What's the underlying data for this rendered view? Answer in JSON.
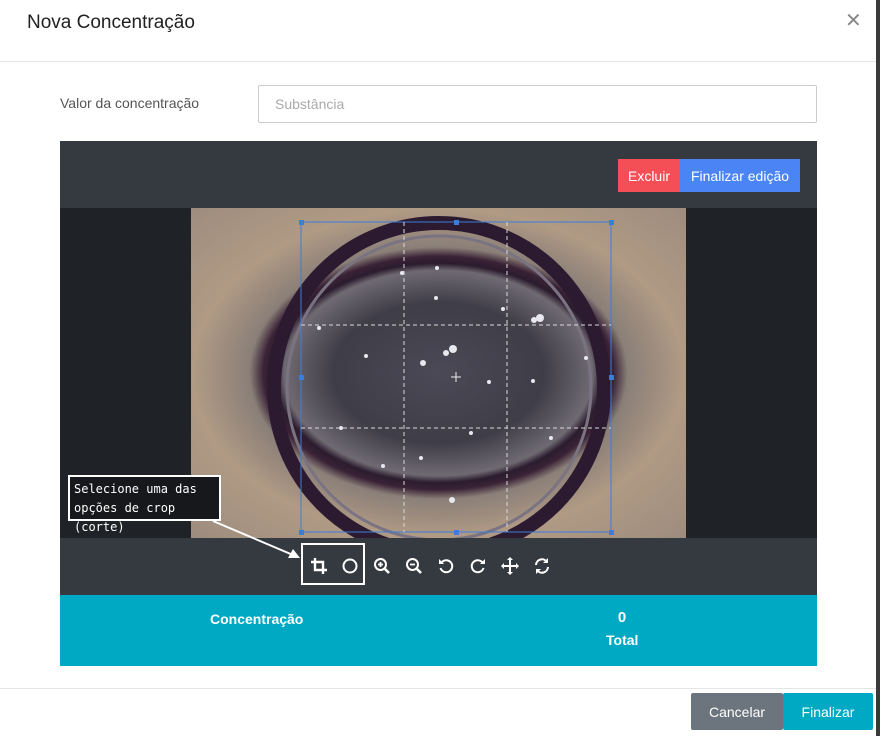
{
  "modal": {
    "title": "Nova Concentração",
    "close_icon": "close-icon"
  },
  "form": {
    "label": "Valor da concentração",
    "input_placeholder": "Substância",
    "input_value": ""
  },
  "editor": {
    "delete_label": "Excluir",
    "finish_edit_label": "Finalizar edição",
    "tools": [
      "crop-icon",
      "circle-icon",
      "zoom-in-icon",
      "zoom-out-icon",
      "rotate-left-icon",
      "rotate-right-icon",
      "move-icon",
      "reset-icon"
    ],
    "colors": {
      "delete": "#f44f57",
      "finish": "#4a84f5",
      "crop_box": "#3b7ddd"
    }
  },
  "annotation": {
    "line1": "Selecione uma das",
    "line2": "opções de crop (corte)"
  },
  "summary": {
    "label": "Concentração",
    "value": "0",
    "value_caption": "Total"
  },
  "footer": {
    "cancel_label": "Cancelar",
    "finish_label": "Finalizar"
  }
}
